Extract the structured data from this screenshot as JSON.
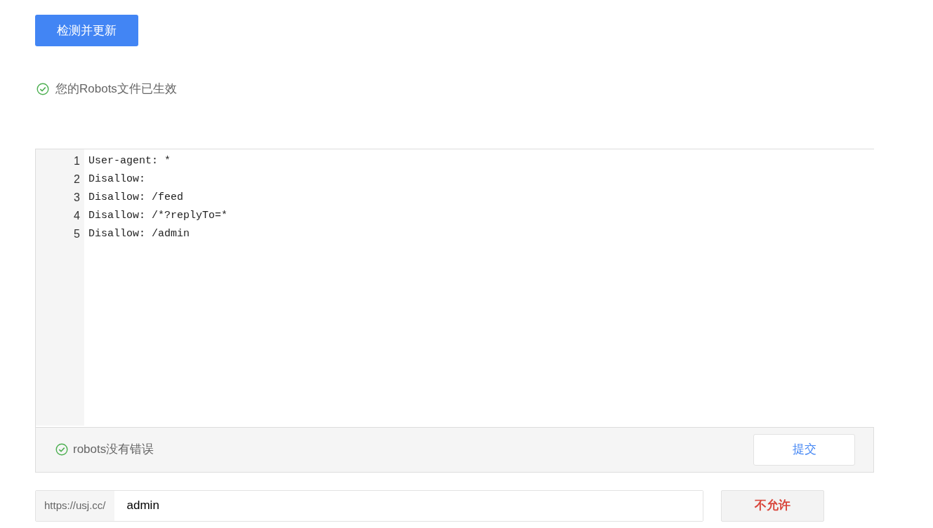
{
  "update_button": "检测并更新",
  "file_status": "您的Robots文件已生效",
  "editor": {
    "lines": [
      {
        "number": "1",
        "text": "User-agent: *"
      },
      {
        "number": "2",
        "text": "Disallow:"
      },
      {
        "number": "3",
        "text": "Disallow: /feed"
      },
      {
        "number": "4",
        "text": "Disallow: /*?replyTo=*"
      },
      {
        "number": "5",
        "text": "Disallow: /admin"
      }
    ],
    "check_status": "robots没有错误",
    "submit_button": "提交"
  },
  "url_test": {
    "prefix": "https://usj.cc/",
    "value": "admin",
    "result": "不允许"
  }
}
